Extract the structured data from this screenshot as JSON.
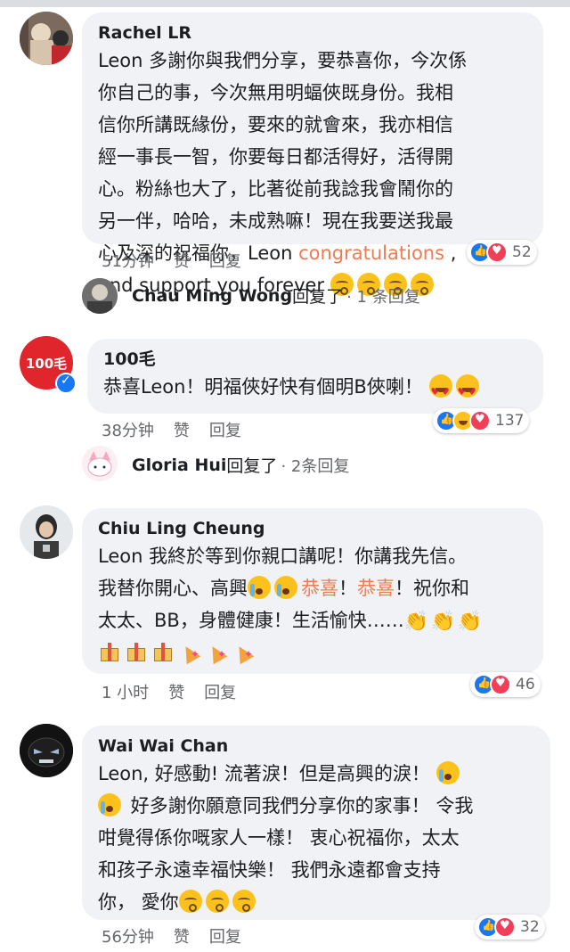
{
  "comments": [
    {
      "author": "Rachel LR",
      "lines": [
        "Leon 多謝你與我們分享，要恭喜你，今次係",
        "你自己的事，今次無用明蝠俠既身份。我相",
        "信你所講既緣份，要來的就會來，我亦相信",
        "經一事長一智，你要每日都活得好，活得開",
        "心。粉絲也大了，比著從前我諗我會鬧你的",
        "另一伴，哈哈，未成熟嘛！現在我要送我最"
      ],
      "line7_pre": "心及深的祝福你，Leon ",
      "line7_highlight": "congratulations",
      "line7_post": " ,",
      "line8": "and support you forever ",
      "time": "51分钟",
      "like_label": "赞",
      "reply_label": "回复",
      "reaction_count": "52",
      "reply": {
        "name": "Chau Ming Wong",
        "tail": "回复了",
        "count": "· 1 条回复"
      }
    },
    {
      "author": "100毛",
      "avatar_text": "100毛",
      "text": "恭喜Leon！明福俠好快有個明B俠喇！",
      "time": "38分钟",
      "like_label": "赞",
      "reply_label": "回复",
      "reaction_count": "137",
      "reply": {
        "name": "Gloria Hui",
        "tail": "回复了",
        "count": "· 2条回复"
      }
    },
    {
      "author": "Chiu Ling Cheung",
      "line1": "Leon 我終於等到你親口講呢！你講我先信。",
      "line2_pre": "我替你開心、高興",
      "line2_hl1": "恭喜",
      "line2_mid": "！",
      "line2_hl2": "恭喜",
      "line2_post": "！祝你和",
      "line3": "太太、BB，身體健康！生活愉快……",
      "time": "1 小时",
      "like_label": "赞",
      "reply_label": "回复",
      "reaction_count": "46"
    },
    {
      "author": "Wai Wai Chan",
      "line1": "Leon, 好感動! 流著淚！但是高興的淚！",
      "line2": " 好多謝你願意同我們分享你的家事！ 令我",
      "line3": "咁覺得係你嘅家人一樣！ 衷心祝福你，太太",
      "line4": "和孩子永遠幸福快樂！ 我們永遠都會支持",
      "line5": "你， 愛你",
      "time": "56分钟",
      "like_label": "赞",
      "reply_label": "回复",
      "reaction_count": "32"
    }
  ],
  "colors": {
    "bubble": "#f0f2f5",
    "highlight": "#f07b52",
    "meta": "#65676b",
    "like": "#1877f2",
    "love": "#f33e58"
  }
}
